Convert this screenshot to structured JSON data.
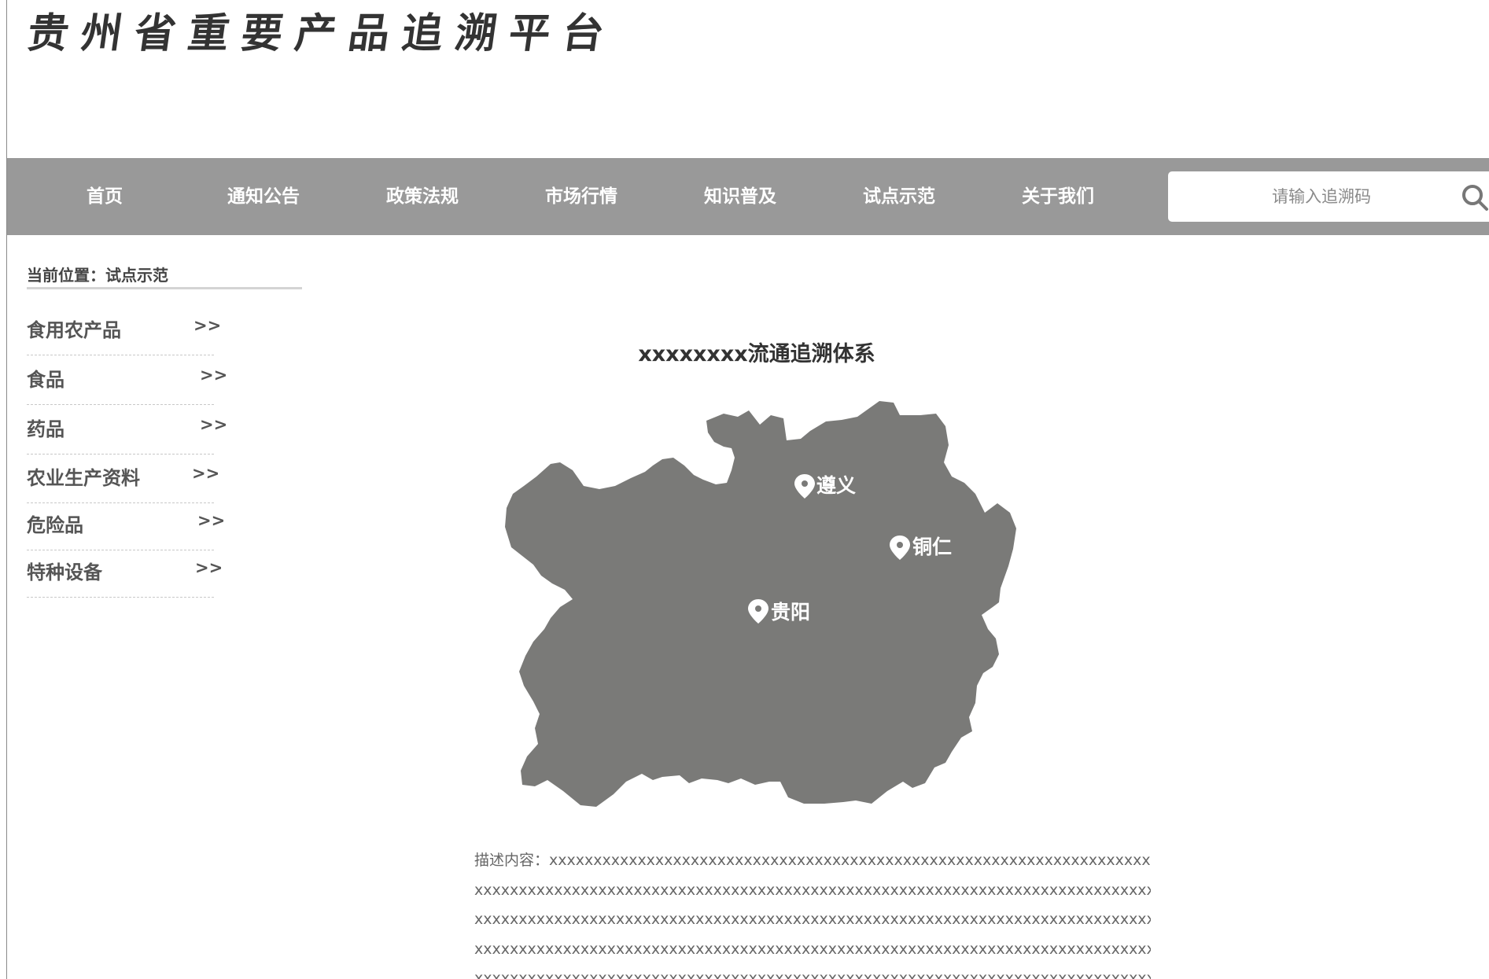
{
  "header": {
    "site_title": "贵州省重要产品追溯平台"
  },
  "nav": {
    "items": [
      {
        "label": "首页"
      },
      {
        "label": "通知公告"
      },
      {
        "label": "政策法规"
      },
      {
        "label": "市场行情"
      },
      {
        "label": "知识普及"
      },
      {
        "label": "试点示范"
      },
      {
        "label": "关于我们"
      }
    ],
    "search": {
      "placeholder": "请输入追溯码",
      "value": "",
      "icon": "search-icon"
    }
  },
  "breadcrumb": {
    "text": "当前位置：试点示范"
  },
  "sidebar": {
    "items": [
      {
        "label": "食用农产品",
        "arrow": ">>"
      },
      {
        "label": "食品",
        "arrow": ">>"
      },
      {
        "label": "药品",
        "arrow": ">>"
      },
      {
        "label": "农业生产资料",
        "arrow": ">>"
      },
      {
        "label": "危险品",
        "arrow": ">>"
      },
      {
        "label": "特种设备",
        "arrow": ">>"
      }
    ]
  },
  "content": {
    "title": "xxxxxxxx流通追溯体系",
    "map": {
      "fill_color": "#7a7a78",
      "cities": [
        {
          "name": "遵义",
          "icon": "map-pin-icon"
        },
        {
          "name": "铜仁",
          "icon": "map-pin-icon"
        },
        {
          "name": "贵阳",
          "icon": "map-pin-icon"
        }
      ]
    },
    "description": {
      "lines": [
        "描述内容：xxxxxxxxxxxxxxxxxxxxxxxxxxxxxxxxxxxxxxxxxxxxxxxxxxxxxxxxxxxxxxxxxxxxxxxxxxxxxxxxxxxxxx",
        "xxxxxxxxxxxxxxxxxxxxxxxxxxxxxxxxxxxxxxxxxxxxxxxxxxxxxxxxxxxxxxxxxxxxxxxxxxxxxxxxxxxxxxxxxxxxxxxxxxx",
        "xxxxxxxxxxxxxxxxxxxxxxxxxxxxxxxxxxxxxxxxxxxxxxxxxxxxxxxxxxxxxxxxxxxxxxxxxxxxxxxxxxxxxxxxxxxxxxxxxx",
        "xxxxxxxxxxxxxxxxxxxxxxxxxxxxxxxxxxxxxxxxxxxxxxxxxxxxxxxxxxxxxxxxxxxxxxxxxxxxxxxxxxxxxxxxxxxxxxxxxx",
        "xxxxxxxxxxxxxxxxxxxxxxxxxxxxxxxxxxxxxxxxxxxxxxxxxxxxxxxxxxxxxxxxxxxxxxxxxxxxxxxxxxxxxxxxxxxxxxxxxx"
      ]
    }
  },
  "colors": {
    "nav_bg": "#999999",
    "nav_text": "#ffffff",
    "map_fill": "#7a7a78",
    "text_dark": "#333333"
  }
}
